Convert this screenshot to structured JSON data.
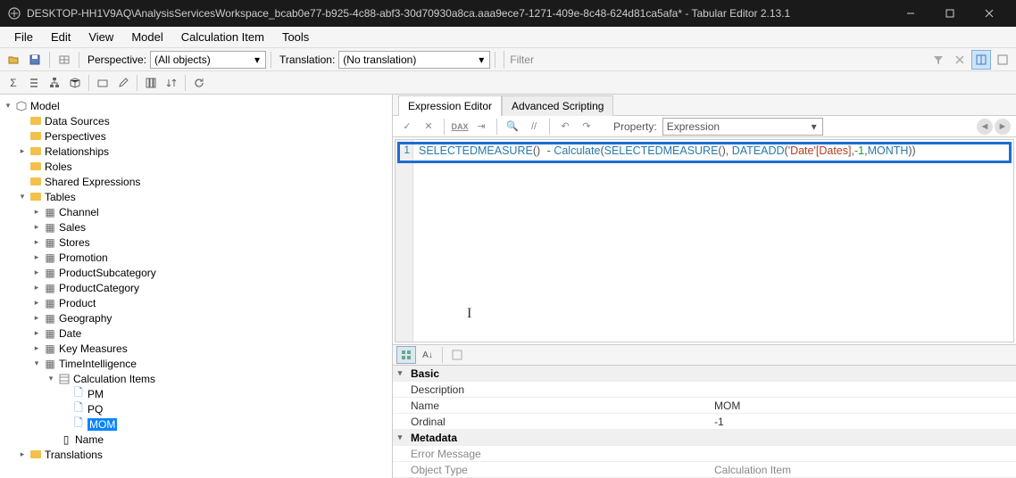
{
  "window": {
    "title": "DESKTOP-HH1V9AQ\\AnalysisServicesWorkspace_bcab0e77-b925-4c88-abf3-30d70930a8ca.aaa9ece7-1271-409e-8c48-624d81ca5afa* - Tabular Editor 2.13.1"
  },
  "menu": {
    "file": "File",
    "edit": "Edit",
    "view": "View",
    "model": "Model",
    "calcitem": "Calculation Item",
    "tools": "Tools"
  },
  "toolbar": {
    "perspective_label": "Perspective:",
    "perspective_value": "(All objects)",
    "translation_label": "Translation:",
    "translation_value": "(No translation)",
    "filter_placeholder": "Filter"
  },
  "tree": {
    "root": "Model",
    "datasources": "Data Sources",
    "perspectives": "Perspectives",
    "relationships": "Relationships",
    "roles": "Roles",
    "sharedexpr": "Shared Expressions",
    "tables": "Tables",
    "t_channel": "Channel",
    "t_sales": "Sales",
    "t_stores": "Stores",
    "t_promotion": "Promotion",
    "t_prodsub": "ProductSubcategory",
    "t_prodcat": "ProductCategory",
    "t_product": "Product",
    "t_geo": "Geography",
    "t_date": "Date",
    "t_keym": "Key Measures",
    "t_timeint": "TimeIntelligence",
    "calcitems": "Calculation Items",
    "ci_pm": "PM",
    "ci_pq": "PQ",
    "ci_mom": "MOM",
    "col_name": "Name",
    "translations": "Translations"
  },
  "tabs": {
    "expr": "Expression Editor",
    "script": "Advanced Scripting"
  },
  "editor": {
    "property_label": "Property:",
    "property_value": "Expression",
    "line_no": "1",
    "tok_selmeas": "SELECTEDMEASURE",
    "tok_calc": "Calculate",
    "tok_dateadd": "DATEADD",
    "tok_tableref": "'Date'[Dates]",
    "tok_neg1": "-1",
    "tok_month": "MONTH",
    "dax_label": "DAX"
  },
  "props": {
    "cat_basic": "Basic",
    "description": "Description",
    "name_k": "Name",
    "name_v": "MOM",
    "ordinal_k": "Ordinal",
    "ordinal_v": "-1",
    "cat_meta": "Metadata",
    "errmsg": "Error Message",
    "objtype_k": "Object Type",
    "objtype_v": "Calculation Item"
  }
}
